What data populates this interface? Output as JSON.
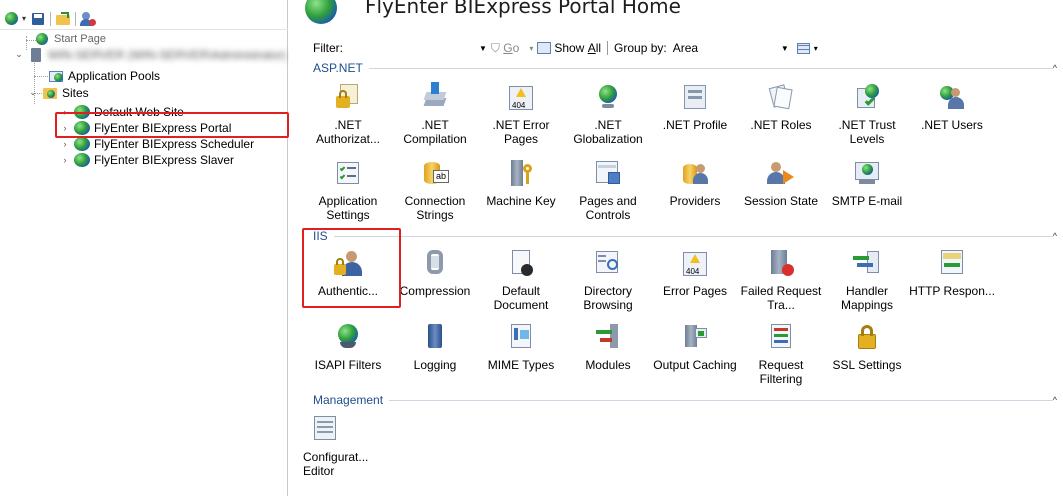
{
  "tree": {
    "start_page": "Start Page",
    "server_name": "WIN-SERVER (WIN-SERVER\\Administrator)",
    "application_pools": "Application Pools",
    "sites": "Sites",
    "site_items": [
      "Default Web Site",
      "FlyEnter BIExpress Portal",
      "FlyEnter BIExpress Scheduler",
      "FlyEnter BIExpress Slaver"
    ]
  },
  "header": {
    "title": "FlyEnter BIExpress Portal Home"
  },
  "filterbar": {
    "filter_label": "Filter:",
    "filter_value": "",
    "go_prefix": "",
    "go_key": "G",
    "go_rest": "o",
    "show_prefix": "Show ",
    "show_key": "A",
    "show_rest": "ll",
    "group_by_label": "Group by:",
    "group_by_value": "Area"
  },
  "sections": {
    "aspnet": {
      "title": "ASP.NET",
      "items": [
        ".NET Authorizat...",
        ".NET Compilation",
        ".NET Error Pages",
        ".NET Globalization",
        ".NET Profile",
        ".NET Roles",
        ".NET Trust Levels",
        ".NET Users",
        "Application Settings",
        "Connection Strings",
        "Machine Key",
        "Pages and Controls",
        "Providers",
        "Session State",
        "SMTP E-mail"
      ]
    },
    "iis": {
      "title": "IIS",
      "items": [
        "Authentic...",
        "Compression",
        "Default Document",
        "Directory Browsing",
        "Error Pages",
        "Failed Request Tra...",
        "Handler Mappings",
        "HTTP Respon...",
        "ISAPI Filters",
        "Logging",
        "MIME Types",
        "Modules",
        "Output Caching",
        "Request Filtering",
        "SSL Settings"
      ]
    },
    "management": {
      "title": "Management",
      "items": [
        "Configurat... Editor"
      ]
    }
  },
  "icons": {
    "error_badge": "404",
    "conn_badge": "ab"
  },
  "colors": {
    "section_title": "#1f4e8c",
    "highlight": "#e02020"
  }
}
